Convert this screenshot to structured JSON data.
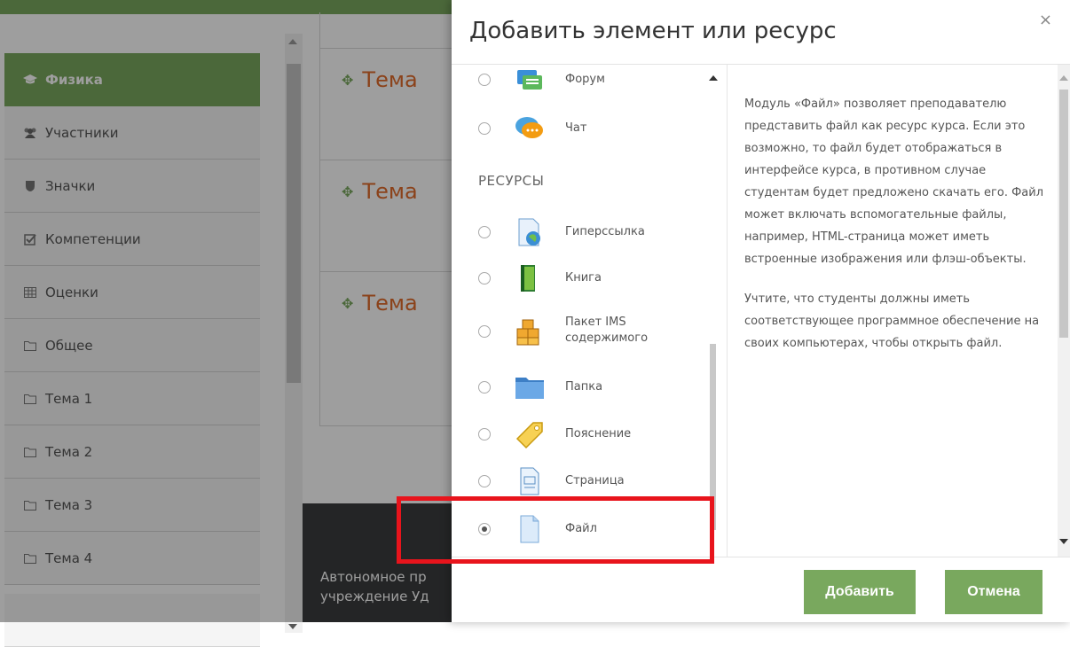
{
  "sidebar": {
    "items": [
      {
        "label": "Физика",
        "icon": "graduation-cap-icon"
      },
      {
        "label": "Участники",
        "icon": "users-icon"
      },
      {
        "label": "Значки",
        "icon": "shield-icon"
      },
      {
        "label": "Компетенции",
        "icon": "checkbox-icon"
      },
      {
        "label": "Оценки",
        "icon": "table-icon"
      },
      {
        "label": "Общее",
        "icon": "folder-icon"
      },
      {
        "label": "Тема 1",
        "icon": "folder-icon"
      },
      {
        "label": "Тема 2",
        "icon": "folder-icon"
      },
      {
        "label": "Тема 3",
        "icon": "folder-icon"
      },
      {
        "label": "Тема 4",
        "icon": "folder-icon"
      }
    ]
  },
  "content": {
    "topics": [
      "Тема",
      "Тема",
      "Тема"
    ],
    "footer_lines": [
      "Автономное пр",
      "учреждение Уд"
    ]
  },
  "modal": {
    "title": "Добавить элемент или ресурс",
    "close": "×",
    "activities": [
      {
        "label": "Форум",
        "icon": "forum-icon"
      },
      {
        "label": "Чат",
        "icon": "chat-icon"
      }
    ],
    "resources_heading": "РЕСУРСЫ",
    "resources": [
      {
        "label": "Гиперссылка",
        "icon": "url-icon",
        "checked": false
      },
      {
        "label": "Книга",
        "icon": "book-icon",
        "checked": false
      },
      {
        "label": "Пакет IMS содержимого",
        "label_line1": "Пакет IMS",
        "label_line2": "содержимого",
        "icon": "ims-package-icon",
        "checked": false
      },
      {
        "label": "Папка",
        "icon": "folder-icon",
        "checked": false
      },
      {
        "label": "Пояснение",
        "icon": "label-tag-icon",
        "checked": false
      },
      {
        "label": "Страница",
        "icon": "page-icon",
        "checked": false
      },
      {
        "label": "Файл",
        "icon": "file-icon",
        "checked": true
      }
    ],
    "description": [
      "Модуль «Файл» позволяет преподавателю представить файл как ресурс курса. Если это возможно, то файл будет отображаться в интерфейсе курса, в противном случае студентам будет предложено скачать его. Файл может включать вспомогательные файлы, например, HTML-страница может иметь встроенные изображения или флэш-объекты.",
      "Учтите, что студенты должны иметь соответствующее программное обеспечение на своих компьютерах, чтобы открыть файл."
    ],
    "add_button": "Добавить",
    "cancel_button": "Отмена"
  },
  "colors": {
    "accent": "#79a85e",
    "topic": "#e06b2b",
    "highlight": "#e8141c",
    "footer": "#3b3d3e"
  }
}
